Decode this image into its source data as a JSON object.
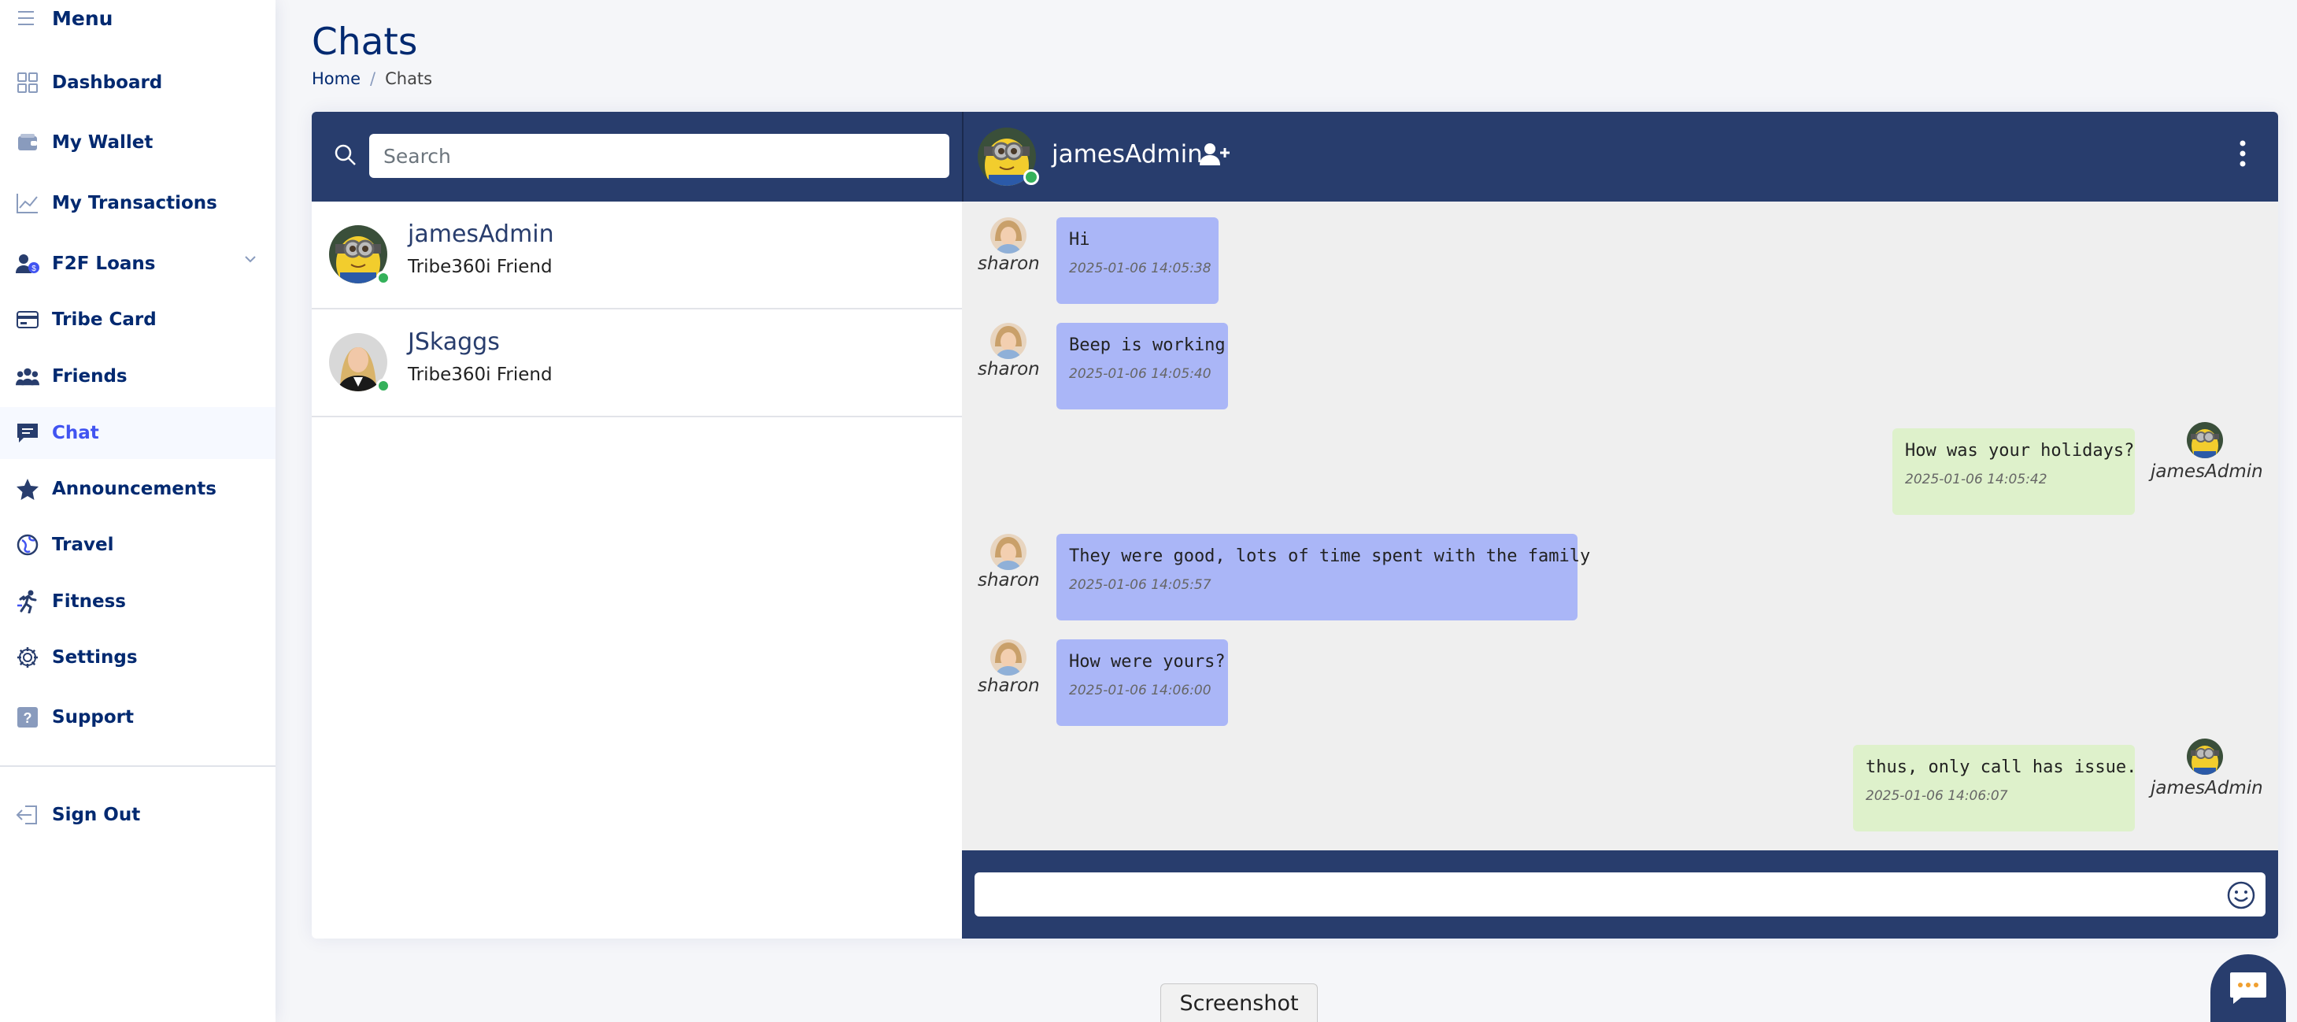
{
  "sidebar": {
    "menu_label": "Menu",
    "items": [
      {
        "label": "Dashboard",
        "icon": "grid-icon"
      },
      {
        "label": "My Wallet",
        "icon": "wallet-icon"
      },
      {
        "label": "My Transactions",
        "icon": "graph-icon"
      },
      {
        "label": "F2F Loans",
        "icon": "people-money-icon"
      },
      {
        "label": "Tribe Card",
        "icon": "card-icon"
      },
      {
        "label": "Friends",
        "icon": "people-icon"
      },
      {
        "label": "Chat",
        "icon": "chat-icon",
        "active": true
      },
      {
        "label": "Announcements",
        "icon": "star-icon"
      },
      {
        "label": "Travel",
        "icon": "globe-icon"
      },
      {
        "label": "Fitness",
        "icon": "runner-icon"
      },
      {
        "label": "Settings",
        "icon": "gear-icon"
      },
      {
        "label": "Support",
        "icon": "question-icon"
      }
    ],
    "signout_label": "Sign Out"
  },
  "header": {
    "title": "Chats",
    "breadcrumb": [
      "Home",
      "Chats"
    ]
  },
  "contacts_panel": {
    "search_placeholder": "Search",
    "contacts": [
      {
        "name": "jamesAdmin",
        "subtitle": "Tribe360i Friend"
      },
      {
        "name": "JSkaggs",
        "subtitle": "Tribe360i Friend"
      }
    ]
  },
  "conversation": {
    "contact_name": "jamesAdmin",
    "messages": [
      {
        "sender": "sharon",
        "text": "Hi",
        "time": "2025-01-06 14:05:38",
        "direction": "in"
      },
      {
        "sender": "sharon",
        "text": "Beep is working",
        "time": "2025-01-06 14:05:40",
        "direction": "in"
      },
      {
        "sender": "jamesAdmin",
        "text": "How was your holidays?",
        "time": "2025-01-06 14:05:42",
        "direction": "out"
      },
      {
        "sender": "sharon",
        "text": "They were good, lots of time spent with the family",
        "time": "2025-01-06 14:05:57",
        "direction": "in"
      },
      {
        "sender": "sharon",
        "text": "How were yours?",
        "time": "2025-01-06 14:06:00",
        "direction": "in"
      },
      {
        "sender": "jamesAdmin",
        "text": "thus, only call has issue.",
        "time": "2025-01-06 14:06:07",
        "direction": "out"
      }
    ]
  },
  "footer": {
    "screenshot_label": "Screenshot"
  },
  "colors": {
    "primary": "#283d6d",
    "accent": "#4154f1",
    "incoming_bubble": "#aab6f7",
    "outgoing_bubble": "#def1cb",
    "online": "#34b15a"
  }
}
